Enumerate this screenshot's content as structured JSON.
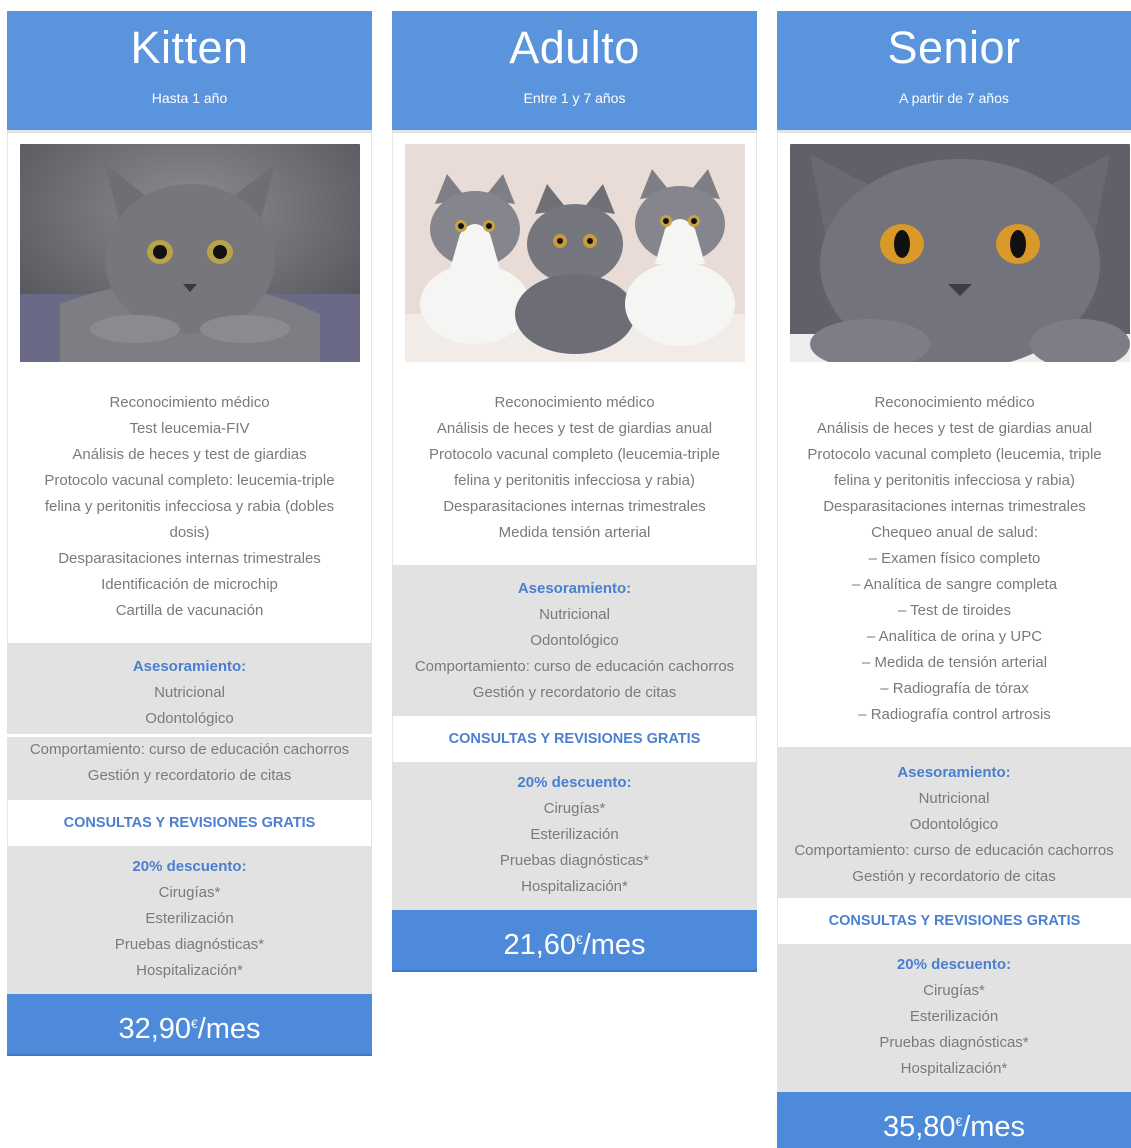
{
  "plans": [
    {
      "name": "Kitten",
      "age": "Hasta 1 año",
      "features": [
        "Reconocimiento médico",
        "Test leucemia-FIV",
        "Análisis de heces y test de giardias",
        "Protocolo vacunal completo: leucemia-triple felina y peritonitis infecciosa y rabia (dobles dosis)",
        "Desparasitaciones internas trimestrales",
        "Identificación de microchip",
        "Cartilla de vacunación"
      ],
      "advice_title": "Asesoramiento:",
      "advice": [
        "Nutricional",
        "Odontológico",
        "Comportamiento: curso de educación cachorros",
        "Gestión y recordatorio de citas"
      ],
      "free": "CONSULTAS Y REVISIONES GRATIS",
      "discount_title": "20% descuento:",
      "discount": [
        "Cirugías*",
        "Esterilización",
        "Pruebas diagnósticas*",
        "Hospitalización*"
      ],
      "price": "32,90",
      "currency": "€",
      "per": "/mes"
    },
    {
      "name": "Adulto",
      "age": "Entre 1 y 7 años",
      "features": [
        "Reconocimiento médico",
        "Análisis de heces y test de giardias anual",
        "Protocolo vacunal completo (leucemia-triple felina y peritonitis infecciosa y rabia)",
        "Desparasitaciones internas trimestrales",
        "Medida tensión arterial"
      ],
      "advice_title": "Asesoramiento:",
      "advice": [
        "Nutricional",
        "Odontológico",
        "Comportamiento: curso de educación cachorros",
        "Gestión y recordatorio de citas"
      ],
      "free": "CONSULTAS Y REVISIONES GRATIS",
      "discount_title": "20% descuento:",
      "discount": [
        "Cirugías*",
        "Esterilización",
        "Pruebas diagnósticas*",
        "Hospitalización*"
      ],
      "price": "21,60",
      "currency": "€",
      "per": "/mes"
    },
    {
      "name": "Senior",
      "age": "A partir de 7 años",
      "features": [
        "Reconocimiento médico",
        "Análisis de heces y test de giardias anual",
        "Protocolo vacunal completo (leucemia, triple felina y peritonitis infecciosa y rabia)",
        "Desparasitaciones internas trimestrales",
        "Chequeo anual de salud:",
        "– Examen físico completo",
        "– Analítica de sangre completa",
        "– Test de tiroides",
        "– Analítica de orina y UPC",
        "– Medida de tensión arterial",
        "– Radiografía de tórax",
        "– Radiografía control artrosis"
      ],
      "advice_title": "Asesoramiento:",
      "advice": [
        "Nutricional",
        "Odontológico",
        "Comportamiento: curso de educación cachorros",
        "Gestión y recordatorio de citas"
      ],
      "free": "CONSULTAS Y REVISIONES GRATIS",
      "discount_title": "20% descuento:",
      "discount": [
        "Cirugías*",
        "Esterilización",
        "Pruebas diagnósticas*",
        "Hospitalización*"
      ],
      "price": "35,80",
      "currency": "€",
      "per": "/mes"
    }
  ],
  "colors": {
    "header": "#5a94dc",
    "accent": "#4a7fcf",
    "gray_box": "#e2e2e2",
    "text": "#7a7a7a"
  }
}
